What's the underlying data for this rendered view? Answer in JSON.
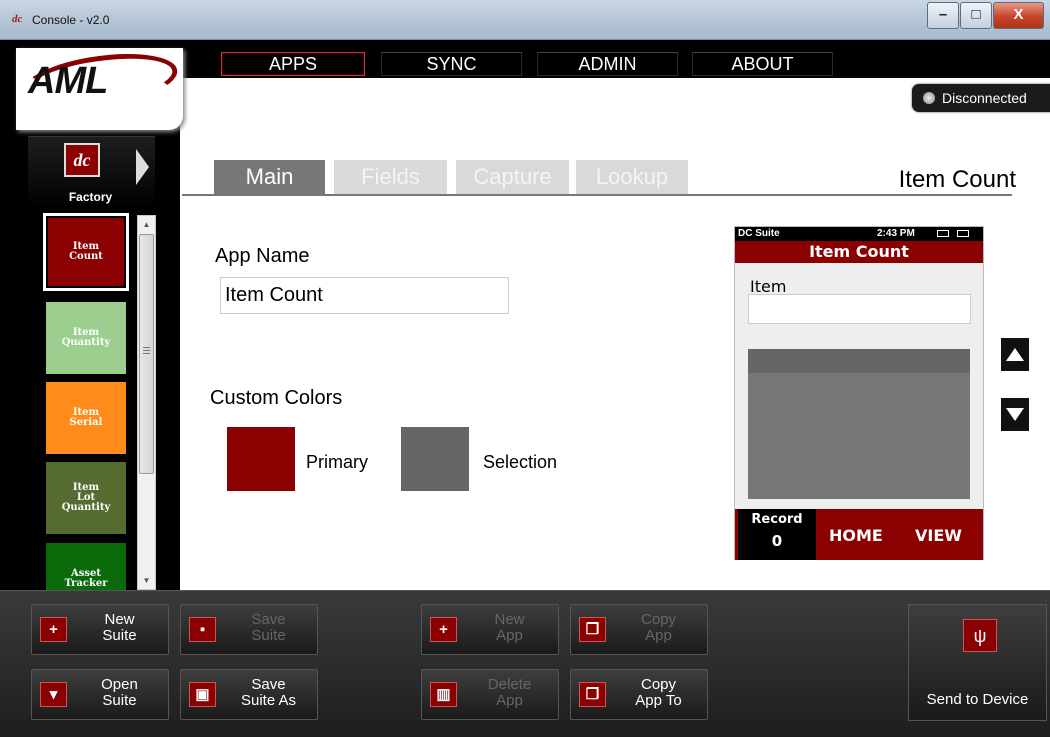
{
  "window": {
    "title": "Console - v2.0",
    "app_icon": "dc",
    "minimize": "–",
    "maximize": "□",
    "close": "X"
  },
  "brand": {
    "logo": "AML"
  },
  "topnav": [
    "APPS",
    "SYNC",
    "ADMIN",
    "ABOUT"
  ],
  "connection": {
    "status": "Disconnected"
  },
  "sidebar": {
    "factory_label": "Factory",
    "factory_icon": "dc",
    "tiles": [
      {
        "label": "Item\nCount",
        "color": "#8b0000"
      },
      {
        "label": "Item\nQuantity",
        "color": "#9ccf8f"
      },
      {
        "label": "Item\nSerial",
        "color": "#ff8c1a"
      },
      {
        "label": "Item\nLot\nQuantity",
        "color": "#556b2f"
      },
      {
        "label": "Asset\nTracker",
        "color": "#0a6b0a"
      }
    ]
  },
  "tabs": [
    {
      "label": "Main",
      "active": true
    },
    {
      "label": "Fields",
      "active": false
    },
    {
      "label": "Capture",
      "active": false
    },
    {
      "label": "Lookup",
      "active": false
    }
  ],
  "main": {
    "heading": "Item Count",
    "app_name_label": "App Name",
    "app_name_value": "Item Count",
    "custom_colors_label": "Custom Colors",
    "primary_label": "Primary",
    "primary_color": "#8b0000",
    "selection_label": "Selection",
    "selection_color": "#666666"
  },
  "device": {
    "status_left": "DC Suite",
    "status_time": "2:43 PM",
    "title": "Item Count",
    "field_label": "Item",
    "record_label": "Record",
    "record_value": "0",
    "home": "HOME",
    "view": "VIEW"
  },
  "toolbar": {
    "new_suite": [
      "New",
      "Suite"
    ],
    "save_suite": [
      "Save",
      "Suite"
    ],
    "new_app": [
      "New",
      "App"
    ],
    "copy_app": [
      "Copy",
      "App"
    ],
    "open_suite": [
      "Open",
      "Suite"
    ],
    "save_suite_as": [
      "Save",
      "Suite As"
    ],
    "delete_app": [
      "Delete",
      "App"
    ],
    "copy_app_to": [
      "Copy",
      "App To"
    ],
    "send_to_device": "Send to Device"
  }
}
